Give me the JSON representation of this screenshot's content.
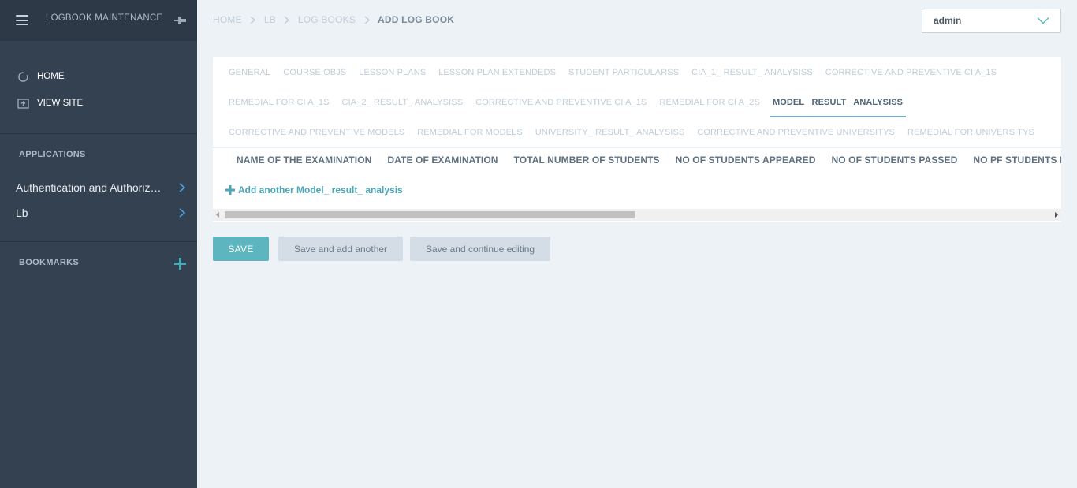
{
  "sidebar": {
    "title": "LOGBOOK MAINTENANCE",
    "links": [
      {
        "label": "HOME"
      },
      {
        "label": "VIEW SITE"
      }
    ],
    "applications_title": "APPLICATIONS",
    "apps": [
      {
        "label": "Authentication and Authorization"
      },
      {
        "label": "Lb"
      }
    ],
    "bookmarks_title": "BOOKMARKS"
  },
  "breadcrumb": {
    "items": [
      "HOME",
      "LB",
      "LOG BOOKS"
    ],
    "current": "ADD LOG BOOK"
  },
  "user": {
    "name": "admin"
  },
  "tabs": {
    "row1": [
      "GENERAL",
      "COURSE OBJS",
      "LESSON PLANS",
      "LESSON PLAN EXTENDEDS",
      "STUDENT PARTICULARSS",
      "CIA_1_ RESULT_ ANALYSISS",
      "CORRECTIVE AND PREVENTIVE CI A_1S"
    ],
    "row2": [
      "REMEDIAL FOR CI A_1S",
      "CIA_2_ RESULT_ ANALYSISS",
      "CORRECTIVE AND PREVENTIVE CI A_1S",
      "REMEDIAL FOR CI A_2S",
      "MODEL_ RESULT_ ANALYSISS"
    ],
    "row3": [
      "CORRECTIVE AND PREVENTIVE MODELS",
      "REMEDIAL FOR MODELS",
      "UNIVERSITY_ RESULT_ ANALYSISS",
      "CORRECTIVE AND PREVENTIVE UNIVERSITYS",
      "REMEDIAL FOR UNIVERSITYS"
    ],
    "active": "MODEL_ RESULT_ ANALYSISS"
  },
  "table": {
    "headers": [
      "NAME OF THE EXAMINATION",
      "DATE OF EXAMINATION",
      "TOTAL NUMBER OF STUDENTS",
      "NO OF STUDENTS APPEARED",
      "NO OF STUDENTS PASSED",
      "NO PF STUDENTS FA"
    ],
    "add_label": "Add another Model_ result_ analysis"
  },
  "buttons": {
    "save": "SAVE",
    "save_add": "Save and add another",
    "save_continue": "Save and continue editing"
  },
  "colors": {
    "sidebar_bg": "#344150",
    "accent": "#5cb5bf",
    "tab_active_underline": "#79aec8"
  }
}
